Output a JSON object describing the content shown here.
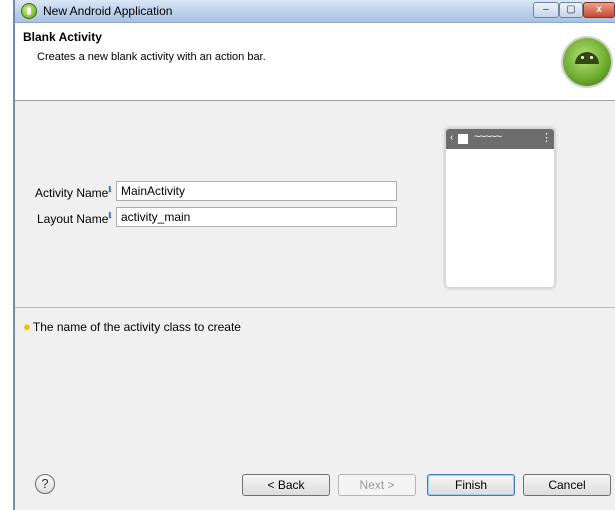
{
  "window": {
    "title": "New Android Application",
    "minimize_symbol": "–",
    "maximize_symbol": "▢",
    "close_symbol": "x"
  },
  "header": {
    "title": "Blank Activity",
    "description": "Creates a new blank activity with an action bar."
  },
  "form": {
    "activity_name_label": "Activity Name",
    "activity_name_value": "MainActivity",
    "layout_name_label": "Layout Name",
    "layout_name_value": "activity_main",
    "info_symbol": "ℹ"
  },
  "preview": {
    "back_glyph": "‹",
    "wave_glyph": "~~~~~",
    "menu_glyph": "⋮"
  },
  "hint": {
    "icon": "lightbulb-icon",
    "text": "The name of the activity class to create"
  },
  "buttons": {
    "help_label": "?",
    "back_label": "< Back",
    "next_label": "Next >",
    "finish_label": "Finish",
    "cancel_label": "Cancel"
  },
  "colors": {
    "titlebar": "#b9cfe9",
    "header_bg": "#ffffff",
    "dialog_bg": "#f0f0f0",
    "android_green": "#6ba82c",
    "default_button_border": "#3c7fb1"
  }
}
